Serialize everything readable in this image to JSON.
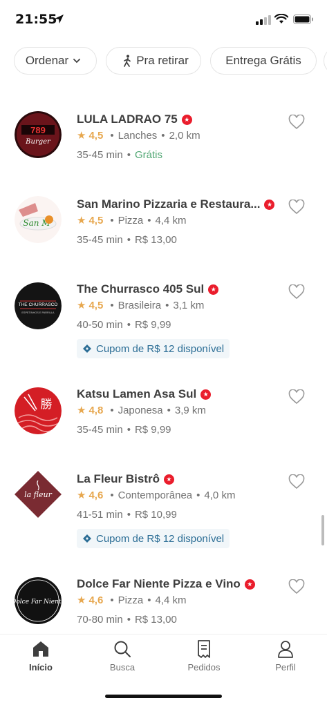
{
  "status_bar": {
    "time": "21:55"
  },
  "filters": {
    "sort_label": "Ordenar",
    "pickup_label": "Pra retirar",
    "free_delivery_label": "Entrega Grátis"
  },
  "restaurants": [
    {
      "name": "LULA LADRAO 75",
      "rating": "4,5",
      "category": "Lanches",
      "distance": "2,0 km",
      "time": "35-45 min",
      "fee": "Grátis",
      "logo_text": "789 Burger"
    },
    {
      "name": "San Marino Pizzaria e Restaura...",
      "rating": "4,5",
      "category": "Pizza",
      "distance": "4,4 km",
      "time": "35-45 min",
      "fee": "R$ 13,00"
    },
    {
      "name": "The Churrasco 405 Sul",
      "rating": "4,5",
      "category": "Brasileira",
      "distance": "3,1 km",
      "time": "40-50 min",
      "fee": "R$ 9,99",
      "coupon": "Cupom de R$ 12 disponível",
      "logo_text": "THE CHURRASCO",
      "logo_subtext": "ESPETINHOS E PARRILLA"
    },
    {
      "name": "Katsu Lamen Asa Sul",
      "rating": "4,8",
      "category": "Japonesa",
      "distance": "3,9 km",
      "time": "35-45 min",
      "fee": "R$ 9,99",
      "logo_text": "勝"
    },
    {
      "name": "La Fleur Bistrô",
      "rating": "4,6",
      "category": "Contemporânea",
      "distance": "4,0 km",
      "time": "41-51 min",
      "fee": "R$ 10,99",
      "coupon": "Cupom de R$ 12 disponível",
      "logo_text": "la fleur"
    },
    {
      "name": "Dolce Far Niente Pizza e Vino",
      "rating": "4,6",
      "category": "Pizza",
      "distance": "4,4 km",
      "time": "70-80 min",
      "fee": "R$ 13,00",
      "logo_text": "Dolce Far Niente"
    }
  ],
  "bottom_nav": {
    "tabs": [
      {
        "label": "Início",
        "icon": "home-icon",
        "active": true
      },
      {
        "label": "Busca",
        "icon": "search-icon"
      },
      {
        "label": "Pedidos",
        "icon": "orders-icon"
      },
      {
        "label": "Perfil",
        "icon": "profile-icon"
      }
    ]
  },
  "colors": {
    "brand_red": "#ea1d2c",
    "rating_gold": "#e7a74e",
    "free_green": "#50a773",
    "coupon_blue": "#2b6d95"
  }
}
